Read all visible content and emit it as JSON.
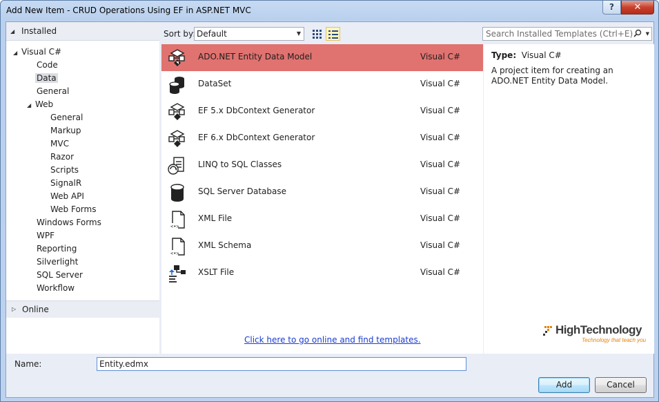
{
  "window": {
    "title": "Add New Item - CRUD Operations Using EF in ASP.NET MVC",
    "help_label": "?",
    "close_label": "✕"
  },
  "left_panel": {
    "installed_label": "Installed",
    "online_label": "Online",
    "tree": [
      {
        "label": "Visual C#",
        "level": 0,
        "expanded": true
      },
      {
        "label": "Code",
        "level": 1
      },
      {
        "label": "Data",
        "level": 1,
        "selected": true
      },
      {
        "label": "General",
        "level": 1
      },
      {
        "label": "Web",
        "level": 1,
        "expanded": true
      },
      {
        "label": "General",
        "level": 2
      },
      {
        "label": "Markup",
        "level": 2
      },
      {
        "label": "MVC",
        "level": 2
      },
      {
        "label": "Razor",
        "level": 2
      },
      {
        "label": "Scripts",
        "level": 2
      },
      {
        "label": "SignalR",
        "level": 2
      },
      {
        "label": "Web API",
        "level": 2
      },
      {
        "label": "Web Forms",
        "level": 2
      },
      {
        "label": "Windows Forms",
        "level": 1
      },
      {
        "label": "WPF",
        "level": 1
      },
      {
        "label": "Reporting",
        "level": 1
      },
      {
        "label": "Silverlight",
        "level": 1
      },
      {
        "label": "SQL Server",
        "level": 1
      },
      {
        "label": "Workflow",
        "level": 1
      }
    ]
  },
  "toolbar": {
    "sort_label": "Sort by:",
    "sort_value": "Default",
    "search_placeholder": "Search Installed Templates (Ctrl+E)"
  },
  "templates": [
    {
      "name": "ADO.NET Entity Data Model",
      "lang": "Visual C#",
      "icon": "entity-model-icon",
      "selected": true
    },
    {
      "name": "DataSet",
      "lang": "Visual C#",
      "icon": "dataset-icon"
    },
    {
      "name": "EF 5.x DbContext Generator",
      "lang": "Visual C#",
      "icon": "ef-generator-icon"
    },
    {
      "name": "EF 6.x DbContext Generator",
      "lang": "Visual C#",
      "icon": "ef-generator-icon"
    },
    {
      "name": "LINQ to SQL Classes",
      "lang": "Visual C#",
      "icon": "linq-to-sql-icon"
    },
    {
      "name": "SQL Server Database",
      "lang": "Visual C#",
      "icon": "database-icon"
    },
    {
      "name": "XML File",
      "lang": "Visual C#",
      "icon": "xml-file-icon"
    },
    {
      "name": "XML Schema",
      "lang": "Visual C#",
      "icon": "xml-schema-icon"
    },
    {
      "name": "XSLT File",
      "lang": "Visual C#",
      "icon": "xslt-file-icon"
    }
  ],
  "online_link": "Click here to go online and find templates.",
  "details": {
    "type_label": "Type:",
    "type_value": "Visual C#",
    "description": "A project item for creating an ADO.NET Entity Data Model."
  },
  "brand": {
    "name": "HighTechnology",
    "tagline": "Technology that teach you",
    "color": "#e5830f"
  },
  "bottom": {
    "name_label": "Name:",
    "name_value": "Entity.edmx",
    "add_label": "Add",
    "cancel_label": "Cancel"
  }
}
